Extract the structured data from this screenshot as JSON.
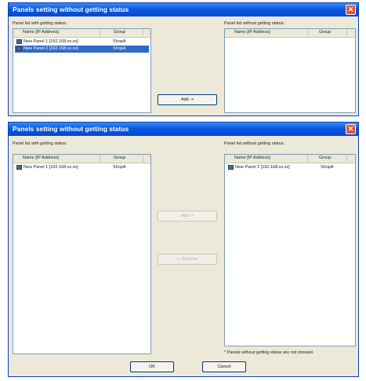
{
  "dialog_top": {
    "title": "Panels setting without getting status",
    "left_label": "Panel list with getting status:",
    "right_label": "Panel list without getting status:",
    "columns": {
      "name": "Name [IP Address]",
      "group": "Group"
    },
    "left_rows": [
      {
        "name": "New Panel 1 [192.168.xx.xx]",
        "group": "ShopA",
        "selected": false
      },
      {
        "name": "New Panel 2 [192.168.xx.xx]",
        "group": "ShopA",
        "selected": true
      }
    ],
    "right_rows": [],
    "add_button": "Add ->"
  },
  "dialog_bottom": {
    "title": "Panels setting without getting status",
    "left_label": "Panel list with getting status:",
    "right_label": "Panel list without getting status:",
    "columns": {
      "name": "Name [IP Address]",
      "group": "Group"
    },
    "left_rows": [
      {
        "name": "New Panel 1 [192.168.xx.xx]",
        "group": "ShopA"
      }
    ],
    "right_rows": [
      {
        "name": "New Panel 2 [192.168.xx.xx]",
        "group": "ShopA"
      }
    ],
    "add_button": "Add ->",
    "remove_button": "<- Remove",
    "note": "* Panels without getting status are not showed.",
    "ok_button": "OK",
    "cancel_button": "Cancel"
  },
  "icons": {
    "close": "close-icon",
    "panel": "panel-icon"
  }
}
